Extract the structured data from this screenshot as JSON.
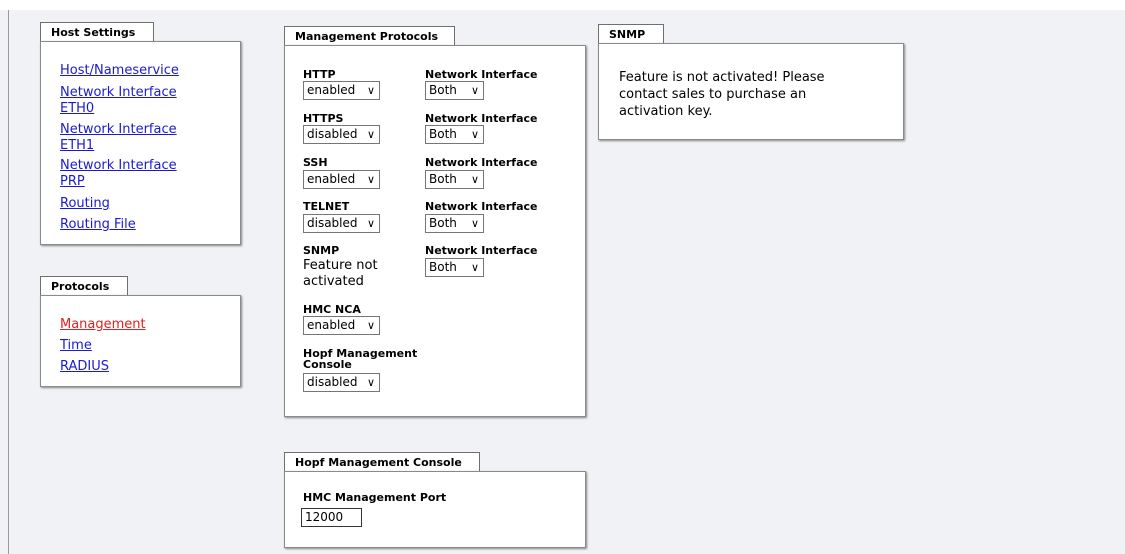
{
  "host_settings": {
    "tab_label": "Host Settings",
    "links": [
      {
        "label": "Host/Nameservice"
      },
      {
        "line1": "Network Interface",
        "line2": "ETH0"
      },
      {
        "line1": "Network Interface",
        "line2": "ETH1"
      },
      {
        "line1": "Network Interface",
        "line2": "PRP"
      },
      {
        "label": "Routing"
      },
      {
        "label": "Routing File"
      }
    ]
  },
  "protocols": {
    "tab_label": "Protocols",
    "links": [
      {
        "label": "Management",
        "active": true
      },
      {
        "label": "Time"
      },
      {
        "label": "RADIUS"
      }
    ]
  },
  "management_protocols": {
    "tab_label": "Management Protocols",
    "rows": [
      {
        "label": "HTTP",
        "value": "enabled",
        "iface_label": "Network Interface",
        "iface_value": "Both"
      },
      {
        "label": "HTTPS",
        "value": "disabled",
        "iface_label": "Network Interface",
        "iface_value": "Both"
      },
      {
        "label": "SSH",
        "value": "enabled",
        "iface_label": "Network Interface",
        "iface_value": "Both"
      },
      {
        "label": "TELNET",
        "value": "disabled",
        "iface_label": "Network Interface",
        "iface_value": "Both"
      },
      {
        "label": "SNMP",
        "status_line1": "Feature not",
        "status_line2": "activated",
        "iface_label": "Network Interface",
        "iface_value": "Both"
      },
      {
        "label": "HMC NCA",
        "value": "enabled"
      },
      {
        "label_line1": "Hopf Management",
        "label_line2": "Console",
        "value": "disabled"
      }
    ]
  },
  "hopf_console": {
    "tab_label": "Hopf Management Console",
    "port_label": "HMC Management Port",
    "port_value": "12000"
  },
  "snmp": {
    "tab_label": "SNMP",
    "message_lines": [
      "Feature is not activated! Please",
      "contact sales to purchase an",
      "activation key."
    ]
  },
  "icons": {
    "dropdown": "chevron-down-icon"
  },
  "colors": {
    "link": "#1a1ad0",
    "active_link": "#e02020",
    "background": "#f0f2f5"
  }
}
